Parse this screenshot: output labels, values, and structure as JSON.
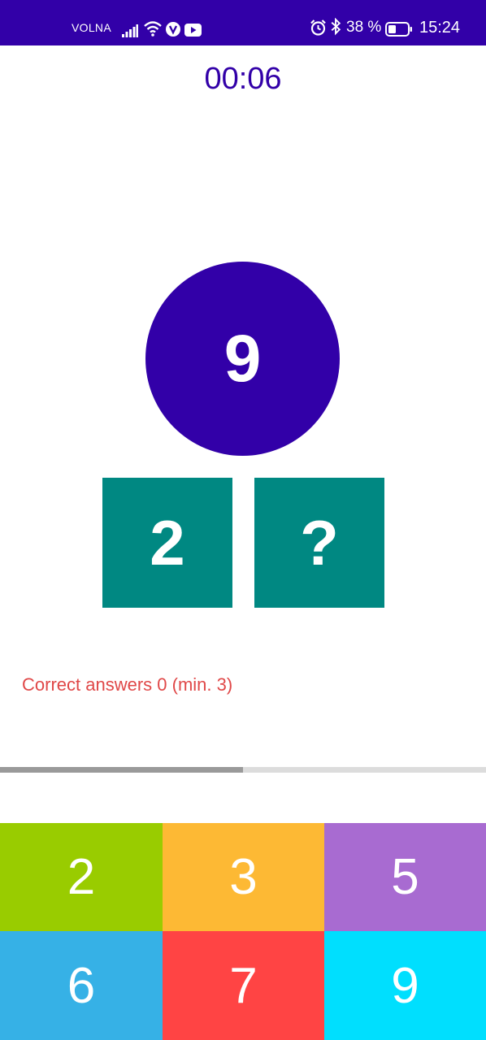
{
  "status_bar": {
    "carrier": "VOLNA",
    "battery_percent": "38 %",
    "time": "15:24",
    "background": "#3200a8",
    "icons": [
      "signal-icon",
      "wifi-icon",
      "vpn-icon",
      "youtube-icon",
      "alarm-icon",
      "bluetooth-icon",
      "battery-icon"
    ]
  },
  "game": {
    "timer": "00:06",
    "target": "9",
    "operand_left": "2",
    "operand_right": "?",
    "correct_answers": "Correct answers 0 (min. 3)",
    "progress_fraction": 0.5
  },
  "keypad": {
    "keys": [
      {
        "label": "2",
        "color": "#99cc00"
      },
      {
        "label": "3",
        "color": "#fdb934"
      },
      {
        "label": "5",
        "color": "#a86bd1"
      },
      {
        "label": "6",
        "color": "#36b1e6"
      },
      {
        "label": "7",
        "color": "#ff4444"
      },
      {
        "label": "9",
        "color": "#00dffe"
      }
    ]
  },
  "colors": {
    "primary": "#3200a8",
    "teal": "#008882",
    "error": "#e04848"
  }
}
